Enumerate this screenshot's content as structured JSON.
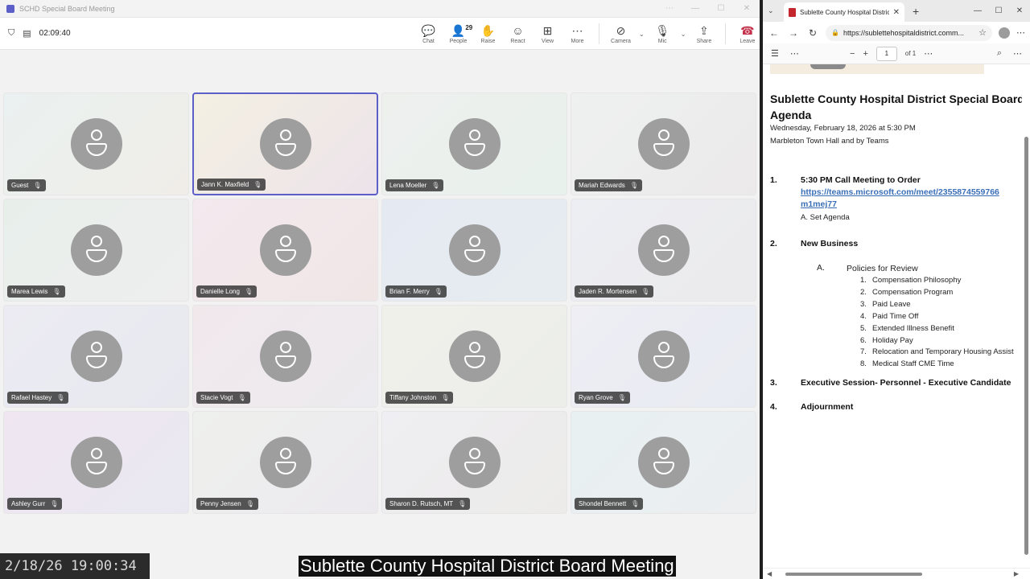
{
  "teams": {
    "window_title": "SCHD Special Board Meeting",
    "timer": "02:09:40",
    "controls": [
      {
        "name": "chat-button",
        "icon": "chat-icon",
        "glyph": "💬",
        "label": "Chat"
      },
      {
        "name": "people-button",
        "icon": "people-icon",
        "glyph": "👤",
        "label": "People",
        "count": "29"
      },
      {
        "name": "raise-hand-button",
        "icon": "hand-icon",
        "glyph": "✋",
        "label": "Raise"
      },
      {
        "name": "react-button",
        "icon": "smile-icon",
        "glyph": "☺",
        "label": "React"
      },
      {
        "name": "view-button",
        "icon": "grid-icon",
        "glyph": "⊞",
        "label": "View"
      },
      {
        "name": "more-button",
        "icon": "more-icon",
        "glyph": "⋯",
        "label": "More"
      }
    ],
    "camera_label": "Camera",
    "mic_label": "Mic",
    "share_label": "Share",
    "leave_label": "Leave",
    "participants": [
      "Guest",
      "Jann K. Maxfield",
      "Lena Moeller",
      "Mariah Edwards",
      "Marea Lewis",
      "Danielle Long",
      "Brian F. Merry",
      "Jaden R. Mortensen",
      "Rafael Hastey",
      "Stacie Vogt",
      "Tiffany Johnston",
      "Ryan Grove",
      "Ashley Gurr",
      "Penny Jensen",
      "Sharon D. Rutsch, MT",
      "Shondel Bennett"
    ],
    "active_speaker_index": 1
  },
  "overlay": {
    "timestamp": "2/18/26 19:00:34",
    "caption": "Sublette County Hospital District Board Meeting"
  },
  "edge": {
    "tab_title": "Sublette County Hospital District S",
    "url": "https://sublettehospitaldistrict.comm...",
    "page_number": "1",
    "page_count": "of 1"
  },
  "doc": {
    "title_line1": "Sublette County Hospital District Special Board",
    "title_line2": "Agenda",
    "date": "Wednesday, February 18, 2026 at 5:30 PM",
    "location": "Marbleton Town Hall and by Teams",
    "items": [
      {
        "num": "1.",
        "title": "5:30 PM Call Meeting to Order"
      },
      {
        "num": "2.",
        "title": "New Business"
      },
      {
        "num": "3.",
        "title": "Executive Session- Personnel - Executive Candidate"
      },
      {
        "num": "4.",
        "title": "Adjournment"
      }
    ],
    "link_line1": "https://teams.microsoft.com/meet/2355874559766",
    "link_line2": "m1mej77",
    "sub_1a": "A. Set Agenda",
    "sub_2a_letter": "A.",
    "sub_2a_title": "Policies for Review",
    "policies": [
      {
        "n": "1.",
        "t": "Compensation Philosophy"
      },
      {
        "n": "2.",
        "t": "Compensation Program"
      },
      {
        "n": "3.",
        "t": "Paid Leave"
      },
      {
        "n": "4.",
        "t": "Paid Time Off"
      },
      {
        "n": "5.",
        "t": "Extended Illness Benefit"
      },
      {
        "n": "6.",
        "t": "Holiday Pay"
      },
      {
        "n": "7.",
        "t": "Relocation and Temporary Housing Assist"
      },
      {
        "n": "8.",
        "t": "Medical Staff CME Time"
      }
    ]
  },
  "colors": {
    "accent": "#5b5fc7",
    "leave": "#c4314b",
    "link": "#3a6fb8"
  }
}
